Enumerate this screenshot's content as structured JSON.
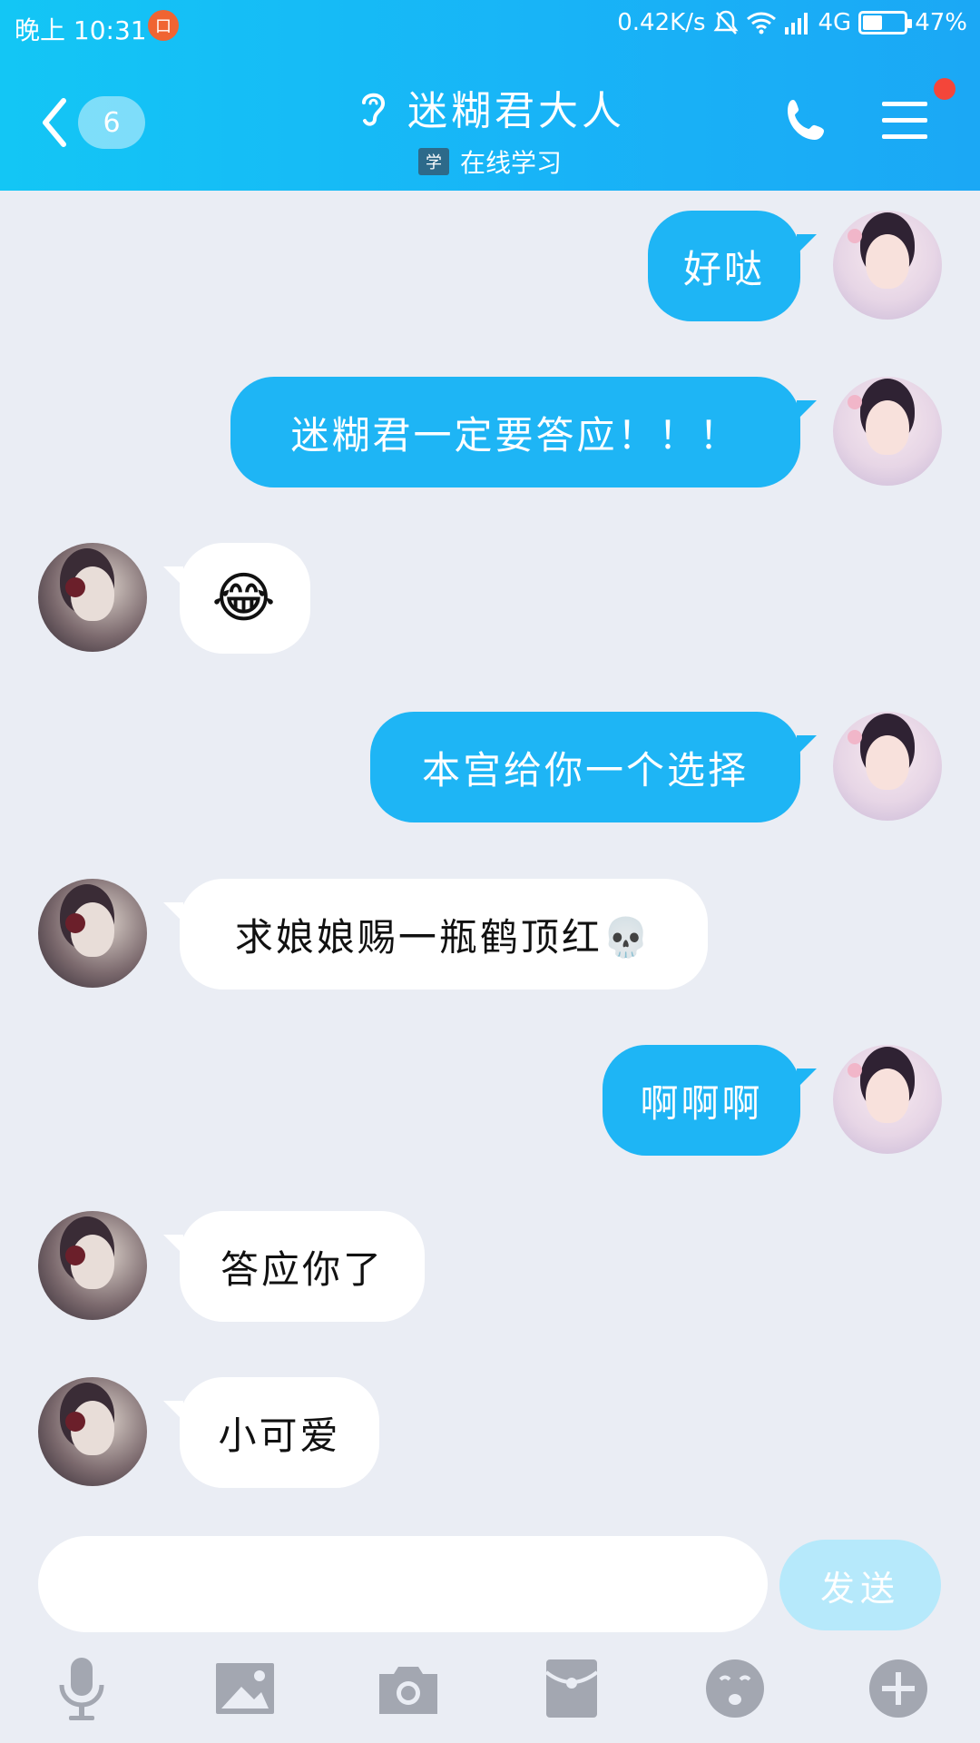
{
  "status_bar": {
    "time": "晚上 10:31",
    "app_badge": "口",
    "net_speed": "0.42K/s",
    "network": "4G",
    "battery": "47%",
    "battery_level": 0.47
  },
  "header": {
    "back_count": "6",
    "title": "迷糊君大人",
    "subtitle_badge": "学",
    "subtitle": "在线学习"
  },
  "messages": [
    {
      "side": "mine",
      "text": "好哒"
    },
    {
      "side": "mine",
      "text": "迷糊君一定要答应！！！"
    },
    {
      "side": "theirs",
      "text": "😂"
    },
    {
      "side": "mine",
      "text": "本宫给你一个选择"
    },
    {
      "side": "theirs",
      "text": "求娘娘赐一瓶鹤顶红💀"
    },
    {
      "side": "mine",
      "text": "啊啊啊"
    },
    {
      "side": "theirs",
      "text": "答应你了"
    },
    {
      "side": "theirs",
      "text": "小可爱"
    }
  ],
  "input": {
    "placeholder": "",
    "send_label": "发送"
  },
  "toolbar": {
    "icons": [
      "microphone-icon",
      "image-icon",
      "camera-icon",
      "red-packet-icon",
      "emoji-icon",
      "plus-icon"
    ]
  },
  "colors": {
    "header": "#18B4F7",
    "my_bubble": "#1EB5F5",
    "their_bubble": "#FFFFFF",
    "background": "#EAEDF4",
    "send_disabled": "#B6E9FB",
    "notification_dot": "#F4463A"
  }
}
